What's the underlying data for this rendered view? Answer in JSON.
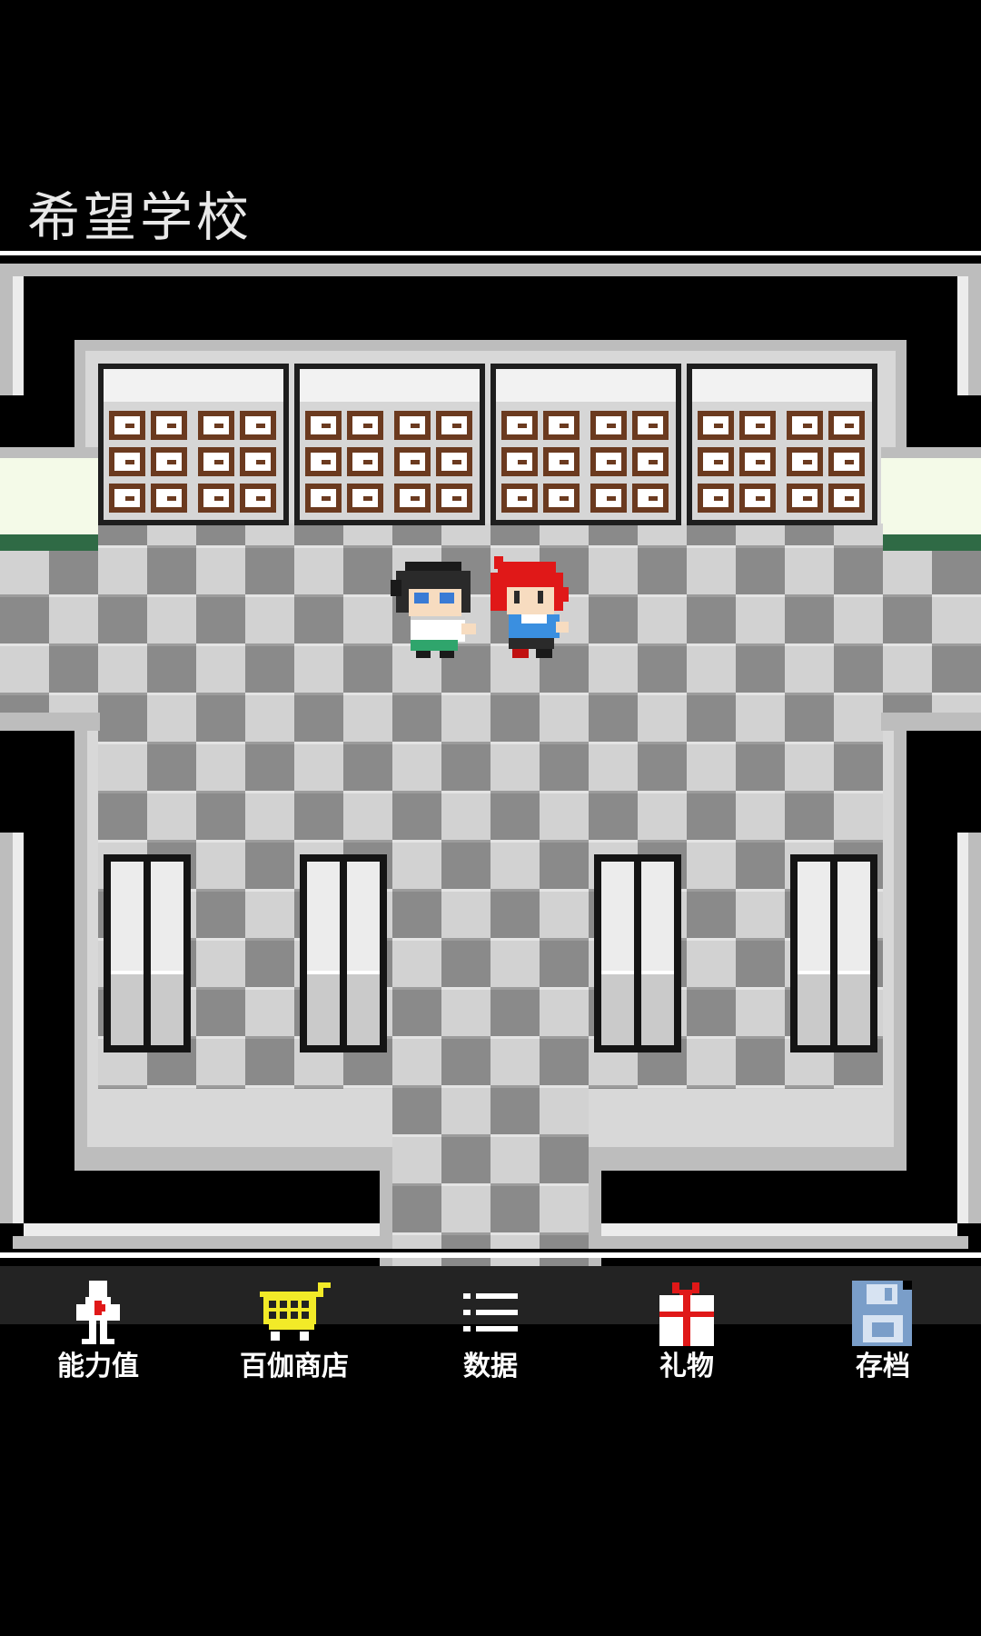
{
  "location": {
    "title": "希望学校"
  },
  "menu": {
    "items": [
      {
        "id": "stats",
        "label": "能力值",
        "icon": "character-stats-icon"
      },
      {
        "id": "shop",
        "label": "百伽商店",
        "icon": "shopping-cart-icon"
      },
      {
        "id": "data",
        "label": "数据",
        "icon": "list-icon"
      },
      {
        "id": "gift",
        "label": "礼物",
        "icon": "gift-icon"
      },
      {
        "id": "save",
        "label": "存档",
        "icon": "floppy-disk-icon"
      }
    ]
  },
  "colors": {
    "background": "#000000",
    "floor_light": "#d0d0d0",
    "floor_dark": "#8a8a8a",
    "wall_frame": "#bdbdbd",
    "cabinet_drawer": "#6b3a1f",
    "side_wall": "#f4fae8",
    "side_wall_trim": "#2f6a45",
    "cart_yellow": "#f2ea28",
    "ribbon_red": "#e01818",
    "floppy_blue": "#7a9ec9",
    "menu_band": "#232323"
  }
}
